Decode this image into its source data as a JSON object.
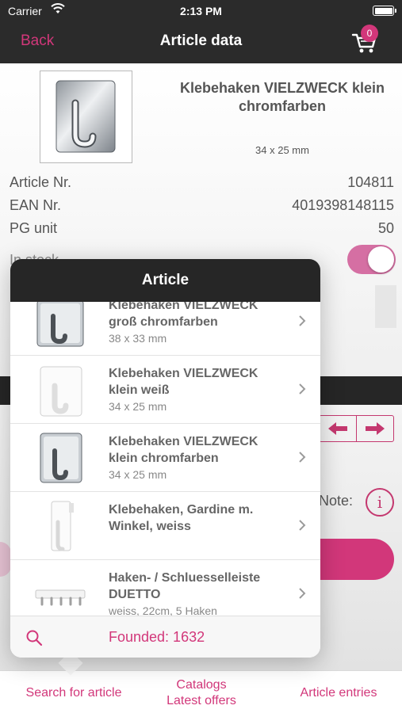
{
  "status_bar": {
    "carrier": "Carrier",
    "time": "2:13 PM"
  },
  "nav": {
    "back_label": "Back",
    "title": "Article data",
    "cart_count": "0"
  },
  "article": {
    "name": "Klebehaken VIELZWECK klein chromfarben",
    "size": "34 x 25 mm",
    "fields": [
      {
        "label": "Article Nr.",
        "value": "104811"
      },
      {
        "label": "EAN Nr.",
        "value": "4019398148115"
      },
      {
        "label": "PG unit",
        "value": "50"
      }
    ],
    "in_stock_label": "In stock",
    "in_stock": true,
    "note_label": "Note:"
  },
  "popover": {
    "title": "Article",
    "items": [
      {
        "name": "Klebehaken VIELZWECK groß chromfarben",
        "sub": "38 x 33 mm",
        "thumb": "chrome-hook"
      },
      {
        "name": "Klebehaken VIELZWECK klein weiß",
        "sub": "34 x 25 mm",
        "thumb": "white-hook"
      },
      {
        "name": "Klebehaken VIELZWECK klein chromfarben",
        "sub": "34 x 25 mm",
        "thumb": "chrome-hook"
      },
      {
        "name": "Klebehaken, Gardine m. Winkel, weiss",
        "sub": "",
        "thumb": "white-angle-hook"
      },
      {
        "name": "Haken- / Schluesselleiste DUETTO",
        "sub": "weiss, 22cm, 5 Haken",
        "thumb": "hook-rack"
      }
    ],
    "found_label": "Founded: 1632"
  },
  "tabs": {
    "search": "Search for article",
    "catalogs_line1": "Catalogs",
    "catalogs_line2": "Latest offers",
    "entries": "Article entries"
  },
  "colors": {
    "accent": "#d2377a",
    "dark": "#2b2b2b"
  }
}
